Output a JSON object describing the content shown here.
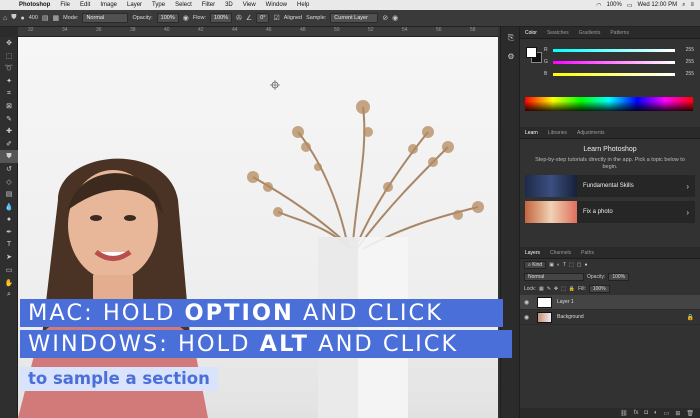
{
  "menubar": {
    "app": "Photoshop",
    "items": [
      "File",
      "Edit",
      "Image",
      "Layer",
      "Type",
      "Select",
      "Filter",
      "3D",
      "View",
      "Window",
      "Help"
    ],
    "battery": "100%",
    "clock": "Wed 12:00 PM"
  },
  "options": {
    "brush_size": "400",
    "mode_label": "Mode:",
    "mode_value": "Normal",
    "opacity_label": "Opacity:",
    "opacity_value": "100%",
    "flow_label": "Flow:",
    "flow_value": "100%",
    "angle_value": "0°",
    "aligned_label": "Aligned",
    "sample_label": "Sample:",
    "sample_value": "Current Layer"
  },
  "ruler": [
    "32",
    "34",
    "36",
    "38",
    "40",
    "42",
    "44",
    "46",
    "48",
    "50",
    "52",
    "54",
    "56",
    "58"
  ],
  "color_panel": {
    "tabs": [
      "Color",
      "Swatches",
      "Gradients",
      "Patterns"
    ],
    "channels": [
      {
        "label": "R",
        "value": "255",
        "color": "#ff0000"
      },
      {
        "label": "G",
        "value": "255",
        "color": "#00c800"
      },
      {
        "label": "B",
        "value": "255",
        "color": "#0032ff"
      }
    ]
  },
  "learn_panel": {
    "tabs": [
      "Learn",
      "Libraries",
      "Adjustments"
    ],
    "title": "Learn Photoshop",
    "description": "Step-by-step tutorials directly in the app. Pick a topic below to begin.",
    "cards": [
      {
        "label": "Fundamental Skills"
      },
      {
        "label": "Fix a photo"
      }
    ]
  },
  "layers_panel": {
    "tabs": [
      "Layers",
      "Channels",
      "Paths"
    ],
    "kind_label": "Kind",
    "blend_value": "Normal",
    "opacity_label": "Opacity:",
    "opacity_value": "100%",
    "lock_label": "Lock:",
    "fill_label": "Fill:",
    "fill_value": "100%",
    "layers": [
      {
        "name": "Layer 1"
      },
      {
        "name": "Background"
      }
    ]
  },
  "captions": {
    "line1_pre": "MAC: HOLD ",
    "line1_key": "OPTION",
    "line1_post": " AND CLICK",
    "line2_pre": "WINDOWS: HOLD ",
    "line2_key": "ALT",
    "line2_post": " AND CLICK",
    "line3": "to sample a section"
  },
  "colors": {
    "caption_blue": "#4a6fd8",
    "caption_light": "#d9e3fb"
  }
}
